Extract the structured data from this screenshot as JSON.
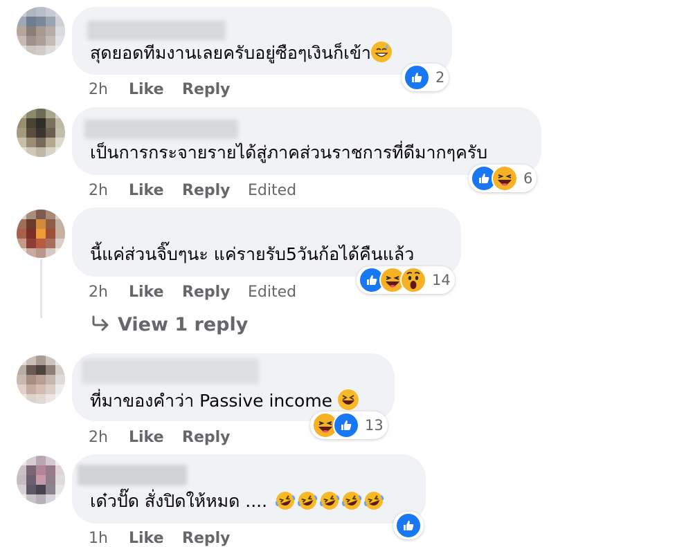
{
  "comments": [
    {
      "text": "สุดยอดทีมงานเลยครับอยู่ซือๆเงินก็เข้า",
      "time": "2h",
      "like": "Like",
      "reply": "Reply",
      "edited": "",
      "reaction_count": "2",
      "reactions": [
        "like"
      ]
    },
    {
      "text": "เป็นการกระจายรายได้สู่ภาคส่วนราชการที่ดีมากๆครับ",
      "time": "2h",
      "like": "Like",
      "reply": "Reply",
      "edited": "Edited",
      "reaction_count": "6",
      "reactions": [
        "like",
        "haha"
      ]
    },
    {
      "text": "นี้แค่ส่วนจิ๊บๆนะ แค่รายรับ5วันก้อได้คืนแล้ว",
      "time": "2h",
      "like": "Like",
      "reply": "Reply",
      "edited": "Edited",
      "reaction_count": "14",
      "reactions": [
        "like",
        "haha",
        "wow"
      ],
      "view_replies": "View 1 reply"
    },
    {
      "text": "ที่มาของคำว่า Passive income",
      "time": "2h",
      "like": "Like",
      "reply": "Reply",
      "edited": "",
      "reaction_count": "13",
      "reactions": [
        "haha",
        "like"
      ]
    },
    {
      "text": "เด๋วปั๊ด สั่งปิดให้หมด ....",
      "time": "1h",
      "like": "Like",
      "reply": "Reply",
      "edited": "",
      "reaction_count": "",
      "reactions": [
        "like"
      ]
    }
  ],
  "colors": {
    "like_blue": "#1877f2",
    "haha_yellow": "#f7b125",
    "bubble_bg": "#f0f2f5",
    "meta_gray": "#65676b"
  }
}
